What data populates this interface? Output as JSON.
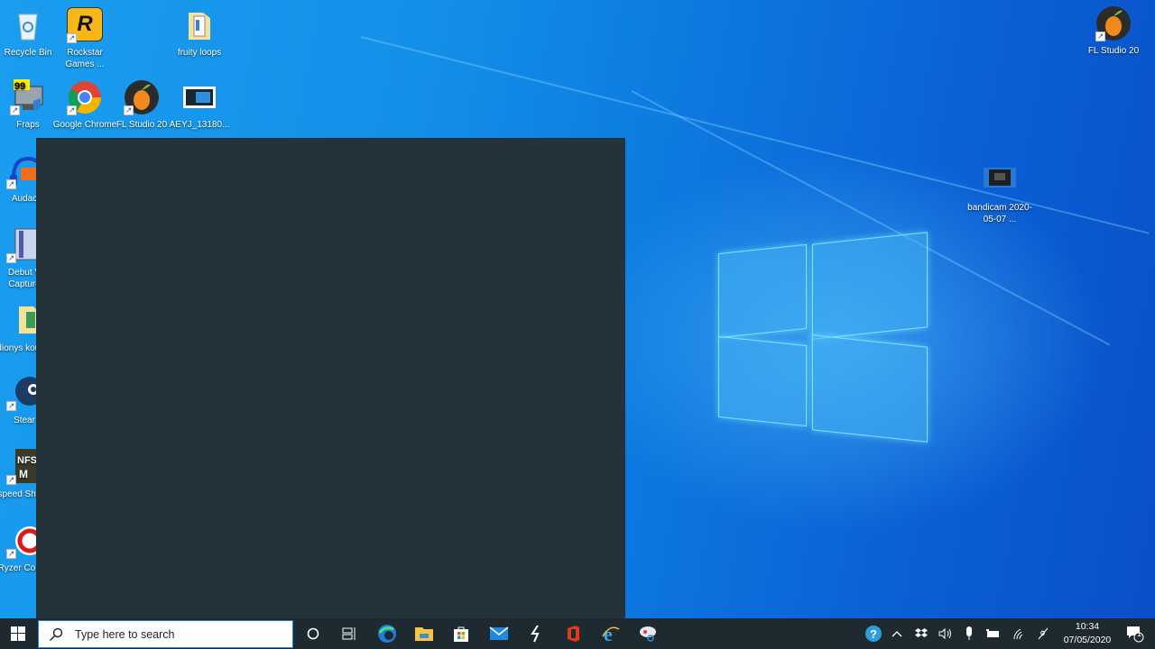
{
  "desktop": {
    "icons": [
      {
        "label": "Recycle Bin",
        "icon": "recycle-bin-icon"
      },
      {
        "label": "Rockstar Games ...",
        "icon": "rockstar-games-icon"
      },
      {
        "label": "fruity loops",
        "icon": "folder-icon"
      },
      {
        "label": "Fraps",
        "icon": "fraps-icon"
      },
      {
        "label": "Google Chrome",
        "icon": "chrome-icon"
      },
      {
        "label": "FL Studio 20",
        "icon": "fl-studio-icon"
      },
      {
        "label": "AEYJ_13180...",
        "icon": "image-file-icon"
      },
      {
        "label": "Audac",
        "icon": "audacity-icon"
      },
      {
        "label": "Debut V Capture",
        "icon": "debut-capture-icon"
      },
      {
        "label": "dionys kousta",
        "icon": "folder-icon"
      },
      {
        "label": "Stear",
        "icon": "steam-icon"
      },
      {
        "label": "speed Shortc",
        "icon": "nfs-most-wanted-icon"
      },
      {
        "label": "Ryzer Contro",
        "icon": "ryzen-controller-icon"
      },
      {
        "label": "FL Studio 20",
        "icon": "fl-studio-icon"
      },
      {
        "label": "bandicam 2020-05-07 ...",
        "icon": "video-file-icon"
      }
    ]
  },
  "taskbar": {
    "start_icon": "windows-logo-icon",
    "search_placeholder": "Type here to search",
    "pinned": [
      {
        "name": "cortana",
        "icon": "cortana-circle-icon"
      },
      {
        "name": "task-view",
        "icon": "task-view-icon"
      },
      {
        "name": "edge",
        "icon": "edge-icon"
      },
      {
        "name": "file-explorer",
        "icon": "file-explorer-icon"
      },
      {
        "name": "microsoft-store",
        "icon": "store-icon"
      },
      {
        "name": "mail",
        "icon": "mail-icon"
      },
      {
        "name": "app-s",
        "icon": "bolt-app-icon"
      },
      {
        "name": "office",
        "icon": "office-icon"
      },
      {
        "name": "internet-explorer",
        "icon": "ie-icon"
      },
      {
        "name": "snipping-tool",
        "icon": "snipping-tool-icon"
      }
    ],
    "tray": {
      "icons": [
        "help-icon",
        "chevron-up-icon",
        "dropbox-icon",
        "volume-icon",
        "microphone-icon",
        "battery-icon",
        "wifi-icon",
        "pen-icon"
      ],
      "time": "10:34",
      "date": "07/05/2020",
      "notification_count": "1"
    }
  },
  "colors": {
    "taskbar": "#1f2a30",
    "dark_window": "#24333a",
    "desktop_blue": "#138fe8"
  }
}
